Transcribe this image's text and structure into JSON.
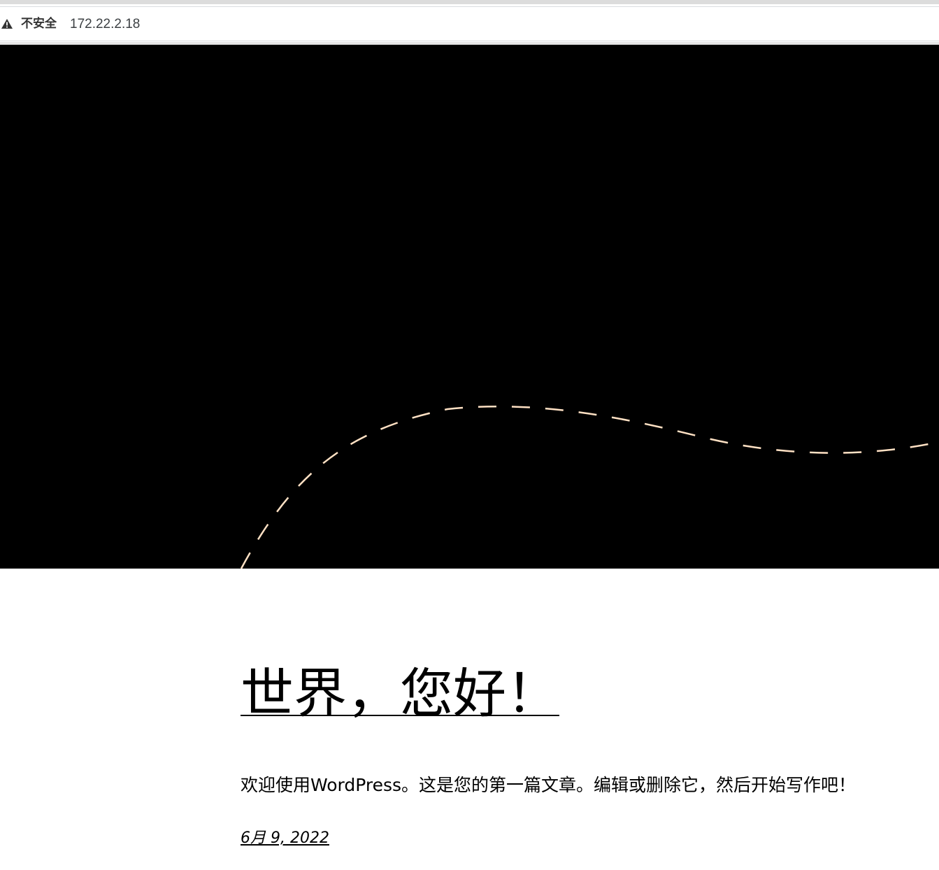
{
  "browser": {
    "security_label": "不安全",
    "url": "172.22.2.18",
    "warning_icon": "warning-triangle-icon"
  },
  "hero": {
    "background_color": "#000000",
    "wave_color": "#ffe1c4"
  },
  "post": {
    "title": "世界，您好！",
    "excerpt": "欢迎使用WordPress。这是您的第一篇文章。编辑或删除它，然后开始写作吧！",
    "date": "6月 9, 2022"
  }
}
